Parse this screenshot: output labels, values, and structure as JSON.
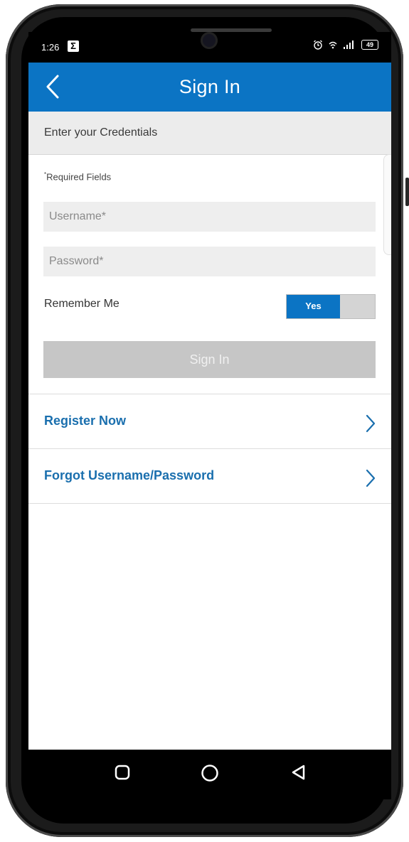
{
  "status_bar": {
    "time": "1:26",
    "notification_icon": "sigma-icon",
    "battery_level": "49",
    "icons": [
      "alarm-icon",
      "wifi-icon",
      "signal-icon",
      "battery-icon"
    ]
  },
  "header": {
    "title": "Sign In",
    "back_icon": "chevron-left-icon",
    "background_color": "#0b74c4"
  },
  "form": {
    "section_title": "Enter your Credentials",
    "required_marker": "*",
    "required_note": "Required Fields",
    "username_placeholder": "Username*",
    "password_placeholder": "Password*",
    "remember_label": "Remember Me",
    "remember_toggle_value": "Yes",
    "remember_toggle_on": true,
    "submit_label": "Sign In"
  },
  "links": [
    {
      "label": "Register Now",
      "icon": "chevron-right-icon"
    },
    {
      "label": "Forgot Username/Password",
      "icon": "chevron-right-icon"
    }
  ],
  "nav_bar": {
    "buttons": [
      "recent-apps-button",
      "home-button",
      "back-button"
    ]
  },
  "colors": {
    "accent": "#0b74c4",
    "link": "#1a6fae",
    "disabled_button": "#c6c6c6"
  }
}
